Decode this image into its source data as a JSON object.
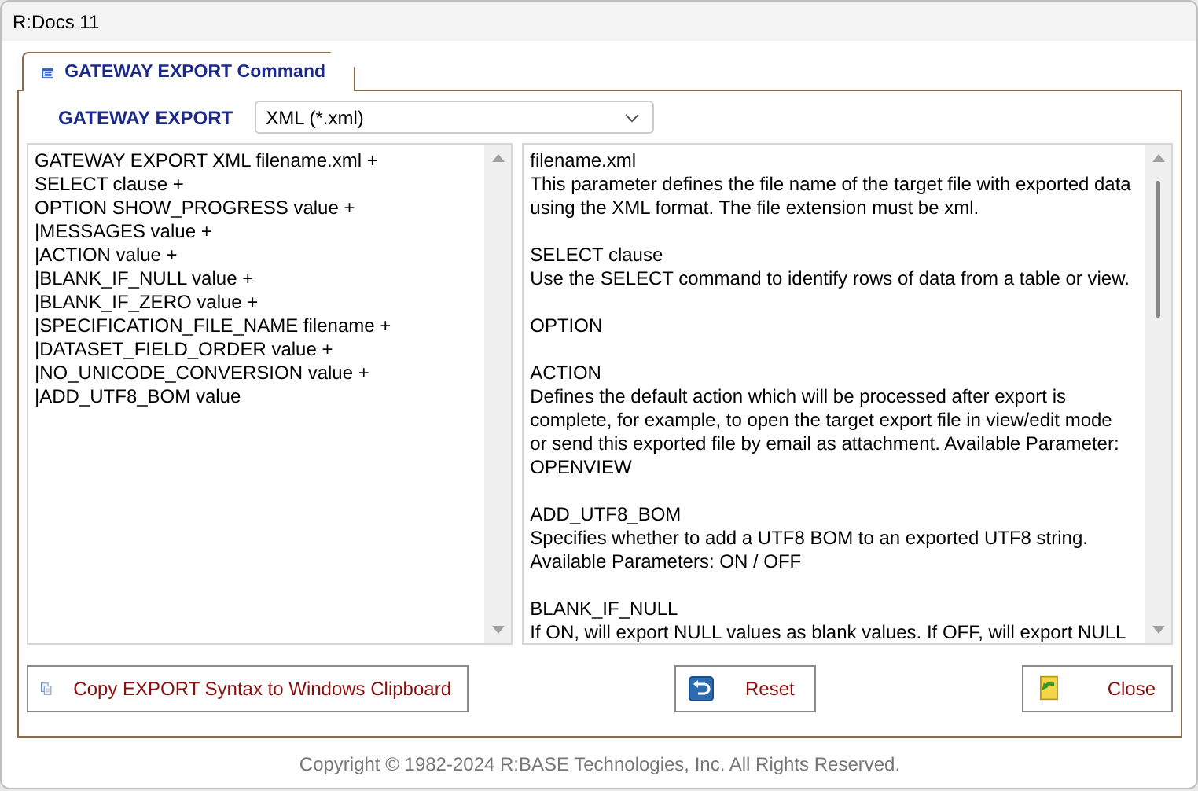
{
  "window": {
    "title": "R:Docs 11"
  },
  "tab": {
    "label": "GATEWAY EXPORT Command",
    "selected": true
  },
  "format": {
    "label": "GATEWAY EXPORT",
    "value": "XML (*.xml)"
  },
  "syntax_lines": [
    "GATEWAY EXPORT XML filename.xml +",
    "SELECT clause +",
    "OPTION SHOW_PROGRESS value +",
    "|MESSAGES value +",
    "|ACTION value +",
    "|BLANK_IF_NULL value +",
    "|BLANK_IF_ZERO value +",
    "|SPECIFICATION_FILE_NAME filename +",
    "|DATASET_FIELD_ORDER value +",
    "|NO_UNICODE_CONVERSION value +",
    "|ADD_UTF8_BOM value"
  ],
  "help_blocks": [
    {
      "lines": [
        "filename.xml",
        "This parameter defines the file name of the target file with exported data",
        "using the XML format. The file extension must be xml."
      ]
    },
    {
      "lines": [
        "SELECT clause",
        "Use the SELECT command to identify rows of data from a table or view."
      ]
    },
    {
      "lines": [
        "OPTION"
      ]
    },
    {
      "lines": [
        "ACTION",
        "Defines the default action which will be processed after export is",
        "complete, for example, to open the target export file in view/edit mode",
        "or send this exported file by email as attachment. Available Parameter:",
        "OPENVIEW"
      ]
    },
    {
      "lines": [
        "ADD_UTF8_BOM",
        "Specifies whether to add a UTF8 BOM to an exported UTF8 string.",
        "Available Parameters: ON / OFF"
      ]
    },
    {
      "lines": [
        "BLANK_IF_NULL",
        "If ON, will export NULL values as blank values. If OFF, will export NULL"
      ]
    }
  ],
  "buttons": [
    {
      "kind": "copy",
      "label": "Copy EXPORT Syntax to Windows Clipboard"
    },
    {
      "kind": "reset",
      "label": "Reset"
    },
    {
      "kind": "close",
      "label": "Close"
    }
  ],
  "copyright": "Copyright © 1982-2024 R:BASE Technologies, Inc. All Rights Reserved."
}
